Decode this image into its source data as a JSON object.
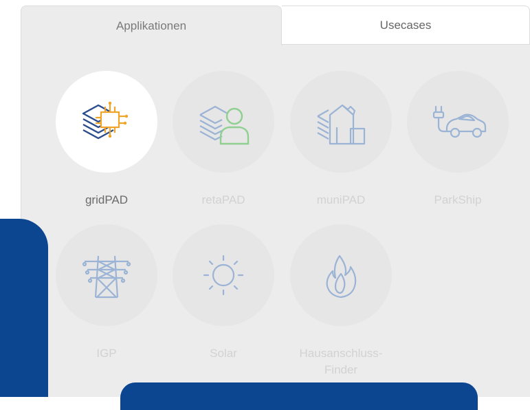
{
  "tabs": [
    {
      "label": "Applikationen",
      "active": true
    },
    {
      "label": "Usecases",
      "active": false
    }
  ],
  "apps": [
    {
      "label": "gridPAD",
      "icon": "gridpad-icon",
      "active": true
    },
    {
      "label": "retaPAD",
      "icon": "retapad-icon",
      "active": false
    },
    {
      "label": "muniPAD",
      "icon": "munipad-icon",
      "active": false
    },
    {
      "label": "ParkShip",
      "icon": "electric-car-icon",
      "active": false
    },
    {
      "label": "IGP",
      "icon": "power-tower-icon",
      "active": false
    },
    {
      "label": "Solar",
      "icon": "sun-icon",
      "active": false
    },
    {
      "label": "Hausanschluss-\nFinder",
      "line1": "Hausanschluss-",
      "line2": "Finder",
      "icon": "flame-icon",
      "active": false
    }
  ],
  "colors": {
    "brand_blue": "#0c4590",
    "accent_orange": "#f0a52a",
    "icon_blue": "#2b4c8c",
    "icon_green": "#8fcf8f",
    "icon_muted_blue": "#9bb3d4"
  }
}
